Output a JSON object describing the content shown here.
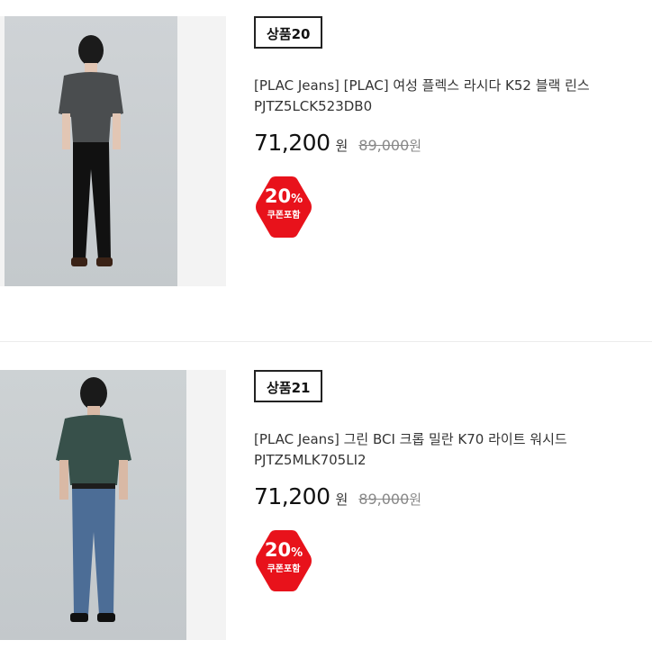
{
  "products": [
    {
      "badge": "상품20",
      "name": "[PLAC Jeans] [PLAC] 여성 플렉스 라시다 K52 블랙 린스 PJTZ5LCK523DB0",
      "price": "71,200",
      "price_unit": "원",
      "original_price": "89,000",
      "original_unit": "원",
      "coupon_percent": "20",
      "coupon_percent_sign": "%",
      "coupon_label": "쿠폰포함",
      "image_icon": "model-photo-black-jeans"
    },
    {
      "badge": "상품21",
      "name": "[PLAC Jeans] 그린 BCI 크롭 밀란 K70 라이트 워시드 PJTZ5MLK705LI2",
      "price": "71,200",
      "price_unit": "원",
      "original_price": "89,000",
      "original_unit": "원",
      "coupon_percent": "20",
      "coupon_percent_sign": "%",
      "coupon_label": "쿠폰포함",
      "image_icon": "model-photo-light-wash-jeans"
    }
  ],
  "colors": {
    "coupon_red": "#e8121b",
    "divider": "#ececec",
    "image_background": "#f3f3f3"
  }
}
